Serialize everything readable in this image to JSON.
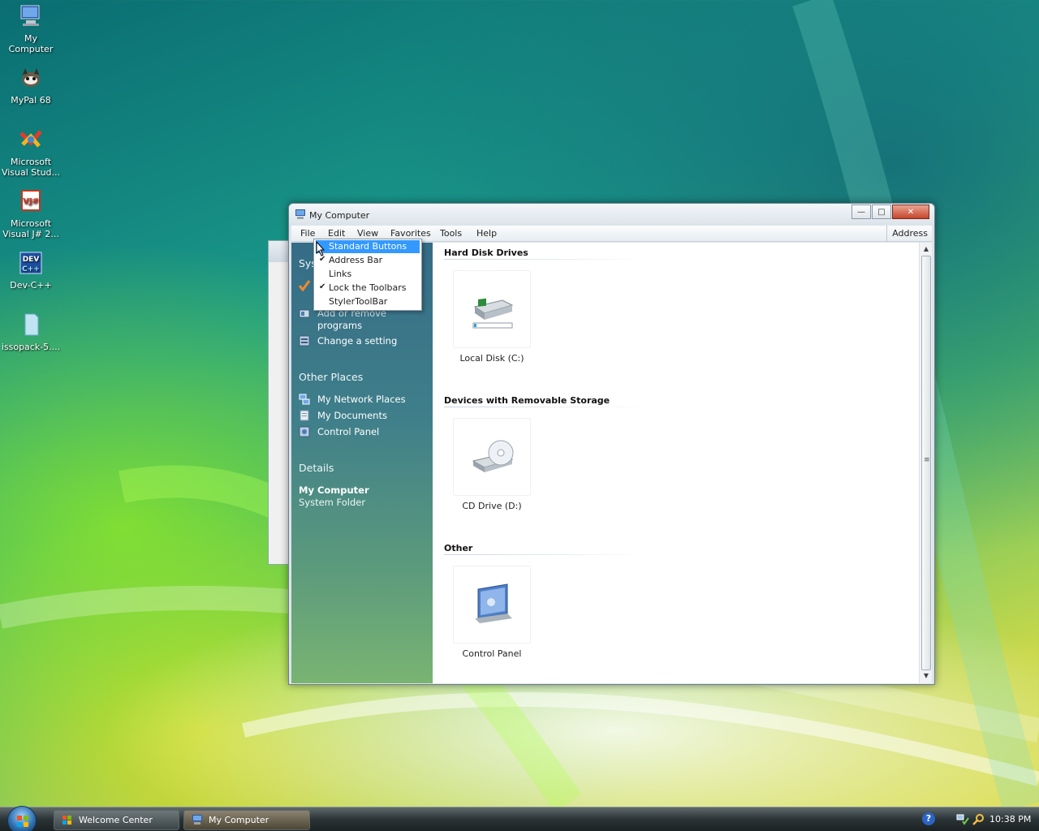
{
  "desktop": {
    "icons": [
      {
        "label": "My Computer",
        "icon": "computer-icon"
      },
      {
        "label": "MyPal 68",
        "icon": "raccoon-icon"
      },
      {
        "label": "Microsoft Visual Stud...",
        "icon": "visual-studio-icon"
      },
      {
        "label": "Microsoft Visual J# 2...",
        "icon": "vjsharp-icon"
      },
      {
        "label": "Dev-C++",
        "icon": "devcpp-icon"
      },
      {
        "label": "issopack-5....",
        "icon": "file-icon"
      }
    ]
  },
  "window": {
    "title": "My Computer",
    "caption": {
      "minimize": "—",
      "maximize": "□",
      "close": "✕"
    },
    "menu": [
      "File",
      "Edit",
      "View",
      "Favorites",
      "Tools",
      "Help"
    ],
    "address_label": "Address",
    "task_pane": {
      "system_heading_partial": "Sys",
      "system_links": [
        "Add or remove programs",
        "Change a setting"
      ],
      "add_remove_line1": "Add or remove",
      "add_remove_line2": "programs",
      "other_places_heading": "Other Places",
      "other_places": [
        "My Network Places",
        "My Documents",
        "Control Panel"
      ],
      "details_heading": "Details",
      "details_title": "My Computer",
      "details_subtitle": "System Folder"
    },
    "groups": [
      {
        "title": "Hard Disk Drives",
        "items": [
          {
            "label": "Local Disk (C:)",
            "icon": "hard-disk-icon"
          }
        ]
      },
      {
        "title": "Devices with Removable Storage",
        "items": [
          {
            "label": "CD Drive (D:)",
            "icon": "cd-drive-icon"
          }
        ]
      },
      {
        "title": "Other",
        "items": [
          {
            "label": "Control Panel",
            "icon": "control-panel-icon"
          }
        ]
      }
    ]
  },
  "context_menu": {
    "items": [
      {
        "label": "Standard Buttons",
        "checked": false,
        "highlighted": true
      },
      {
        "label": "Address Bar",
        "checked": true,
        "highlighted": false
      },
      {
        "label": "Links",
        "checked": false,
        "highlighted": false
      },
      {
        "label": "Lock the Toolbars",
        "checked": true,
        "highlighted": false
      },
      {
        "label": "StylerToolBar",
        "checked": false,
        "highlighted": false
      }
    ],
    "check_glyph": "✔"
  },
  "taskbar": {
    "buttons": [
      {
        "label": "Welcome Center",
        "active": false
      },
      {
        "label": "My Computer",
        "active": true
      }
    ],
    "help_glyph": "?",
    "clock": "10:38 PM"
  },
  "colors": {
    "highlight": "#3399ff",
    "task_pane_top": "#356c86",
    "task_pane_bottom": "#79b472",
    "close_button": "#c6462b"
  }
}
